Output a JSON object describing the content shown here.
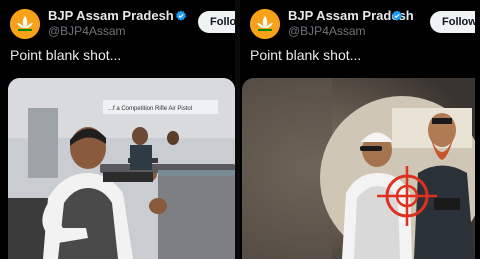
{
  "posts": [
    {
      "account_name": "BJP Assam Pradesh",
      "handle": "@BJP4Assam",
      "follow_label": "Follo",
      "text": "Point blank shot...",
      "media_caption": "...f a Competition Rifle Air Pistol",
      "media_description": "man in vest aiming a rifle at a shooting range"
    },
    {
      "account_name": "BJP Assam Pradesh",
      "handle": "@BJP4Assam",
      "follow_label": "Follow",
      "text": "Point blank shot...",
      "media_description": "animated image with a red crosshair target over two men"
    }
  ],
  "colors": {
    "background": "#000000",
    "text_primary": "#e7e9ea",
    "text_secondary": "#71767b",
    "verified": "#1d9bf0",
    "avatar": "#f7a21b",
    "crosshair": "#e0301e"
  },
  "icons": [
    "lotus-avatar-icon",
    "verified-badge-icon",
    "crosshair-icon"
  ]
}
